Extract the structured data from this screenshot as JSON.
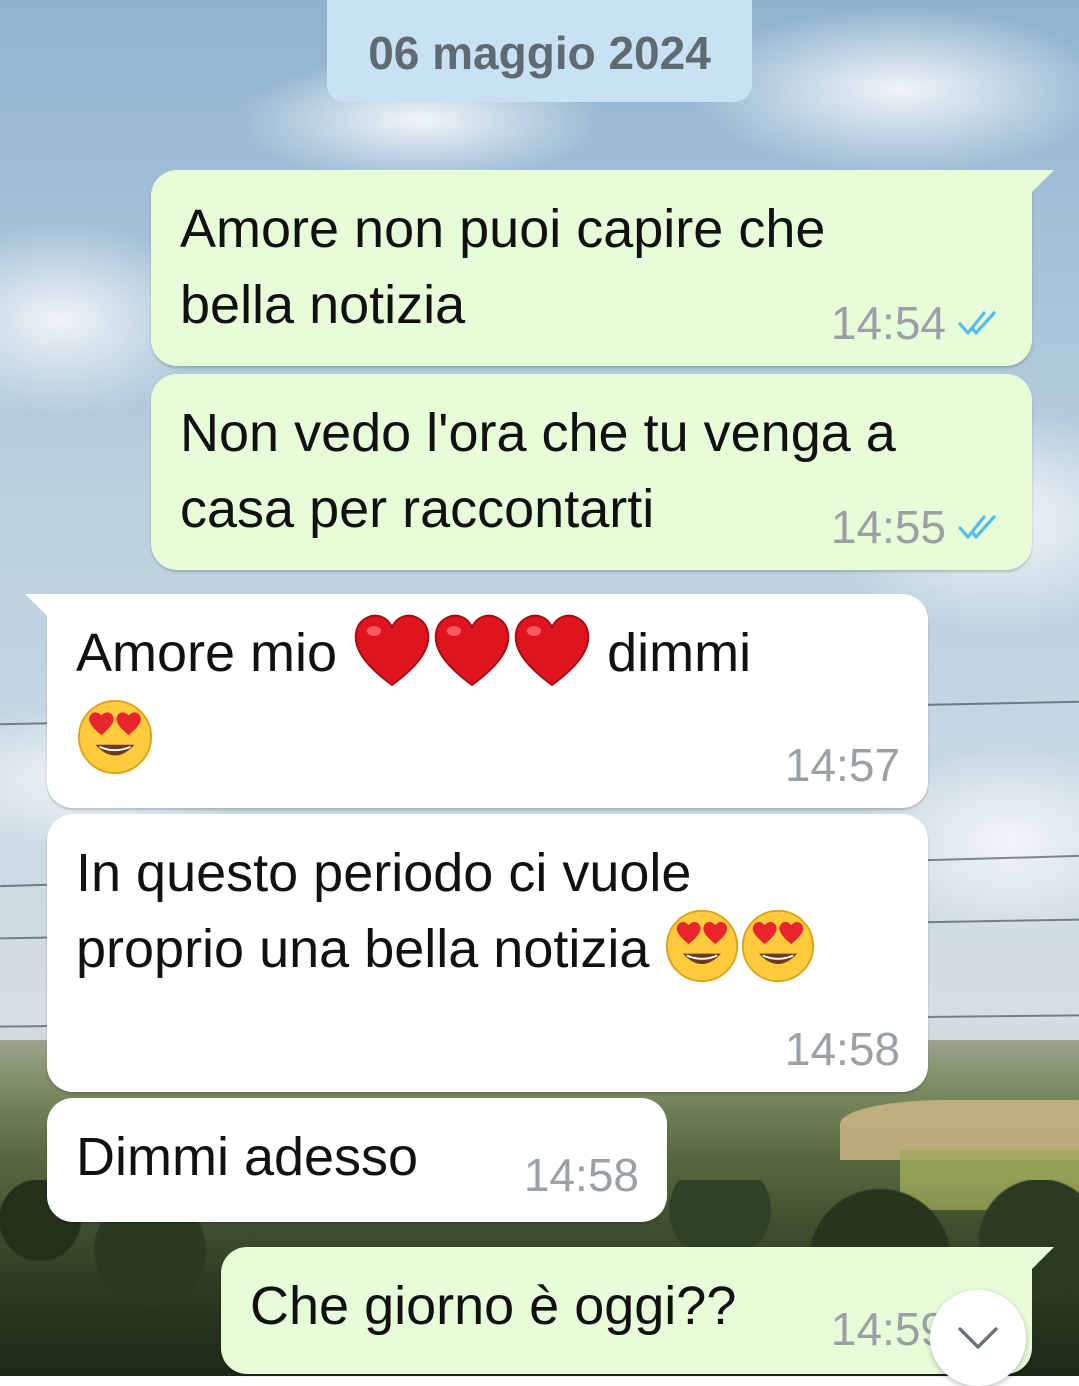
{
  "chat": {
    "date_separator": "06 maggio 2024",
    "messages": [
      {
        "direction": "outgoing",
        "text": "Amore non puoi capire che\nbella notizia",
        "time": "14:54",
        "status": "read"
      },
      {
        "direction": "outgoing",
        "text": "Non vedo l'ora che tu venga a\ncasa per raccontarti",
        "time": "14:55",
        "status": "read"
      },
      {
        "direction": "incoming",
        "text_before": "Amore mio ",
        "emojis": [
          "heart",
          "heart",
          "heart",
          "heart-eyes"
        ],
        "text_after": " dimmi",
        "time": "14:57"
      },
      {
        "direction": "incoming",
        "text_line1": "In questo periodo ci vuole",
        "text_line2": "proprio una bella notizia ",
        "emojis": [
          "heart-eyes",
          "heart-eyes"
        ],
        "time": "14:58"
      },
      {
        "direction": "incoming",
        "text": "Dimmi adesso",
        "time": "14:58"
      },
      {
        "direction": "outgoing",
        "text": "Che giorno è oggi??",
        "time": "14:59",
        "status": "read"
      }
    ]
  },
  "scroll_button": {
    "icon": "chevron-down-icon"
  },
  "colors": {
    "outgoing_bubble": "#e7fcd8",
    "incoming_bubble": "#ffffff",
    "date_chip": "#c9e2f3",
    "read_ticks": "#53bdeb",
    "timestamp": "#9aa0a4"
  }
}
